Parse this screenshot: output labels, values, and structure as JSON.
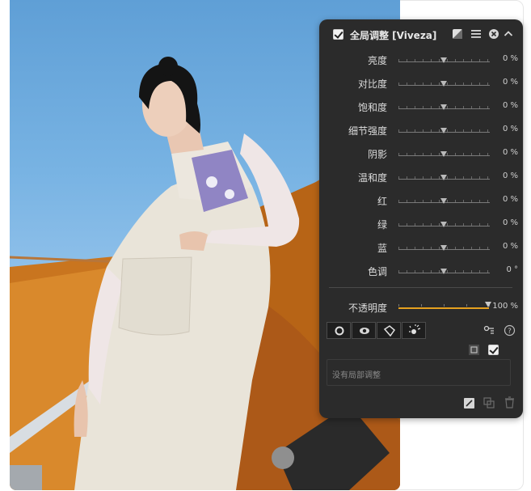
{
  "panel": {
    "title": "全局调整 [Viveza]",
    "enabled": true,
    "sliders": [
      {
        "label": "亮度",
        "value": "0 %"
      },
      {
        "label": "对比度",
        "value": "0 %"
      },
      {
        "label": "饱和度",
        "value": "0 %"
      },
      {
        "label": "细节强度",
        "value": "0 %"
      },
      {
        "label": "阴影",
        "value": "0 %"
      },
      {
        "label": "温和度",
        "value": "0 %"
      },
      {
        "label": "红",
        "value": "0 %"
      },
      {
        "label": "绿",
        "value": "0 %"
      },
      {
        "label": "蓝",
        "value": "0 %"
      },
      {
        "label": "色调",
        "value": "0 °"
      }
    ],
    "opacity": {
      "label": "不透明度",
      "value": "100 %",
      "level": 1.0
    },
    "tools": [
      "circle-point-tool",
      "eye-tool",
      "polygon-tool",
      "brush-tool"
    ],
    "local_adjust_placeholder": "没有局部调整",
    "colors": {
      "panel_bg": "#2b2b2b",
      "accent": "#e6a11f"
    }
  }
}
